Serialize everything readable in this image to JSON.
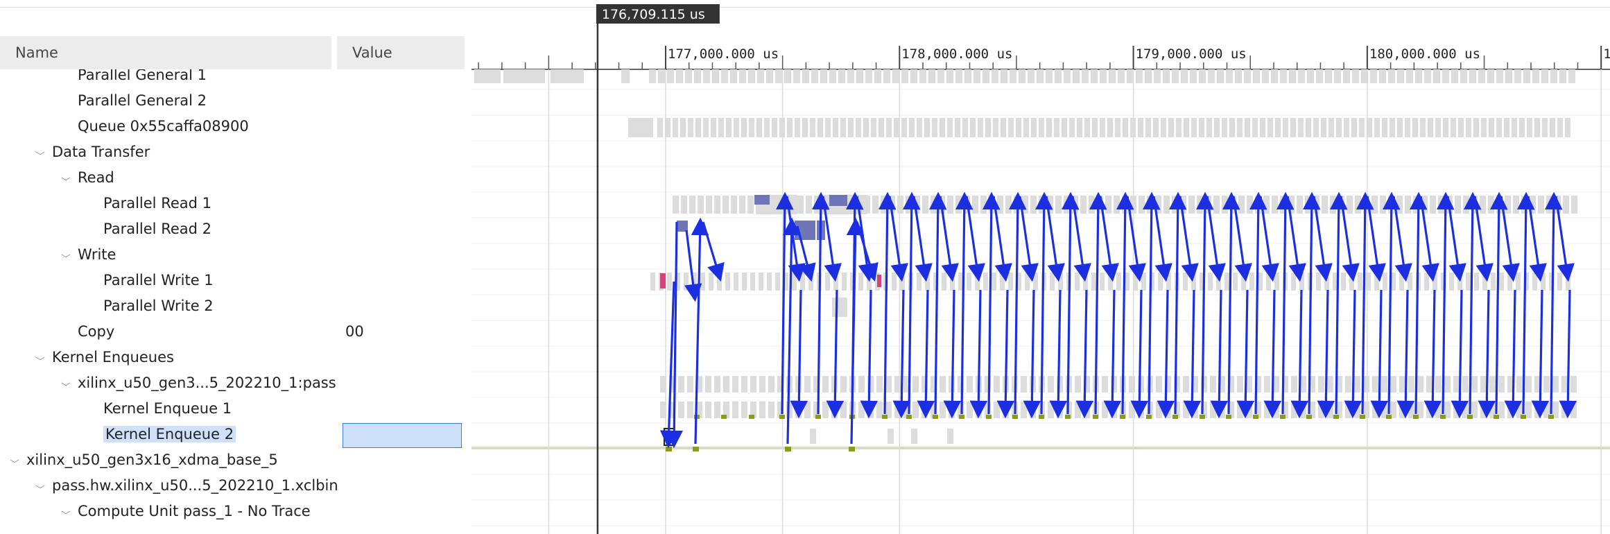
{
  "cursor": {
    "label": "176,709.115 us"
  },
  "columns": {
    "name": "Name",
    "value": "Value"
  },
  "timeline": {
    "start_us": 176000.0,
    "end_us": 180980.0,
    "cursor_us": 176709.115,
    "major_ticks": [
      {
        "us": 177000.0,
        "label": "177,000.000 us"
      },
      {
        "us": 178000.0,
        "label": "178,000.000 us"
      },
      {
        "us": 179000.0,
        "label": "179,000.000 us"
      },
      {
        "us": 180000.0,
        "label": "180,000.000 us"
      },
      {
        "us": 181000.0,
        "label": "1"
      }
    ]
  },
  "rows": [
    {
      "label": "Parallel General 1",
      "indent": 2,
      "chevron": false,
      "value": "",
      "selected": false
    },
    {
      "label": "Parallel General 2",
      "indent": 2,
      "chevron": false,
      "value": "",
      "selected": false
    },
    {
      "label": "Queue 0x55caffa08900",
      "indent": 2,
      "chevron": false,
      "value": "",
      "selected": false
    },
    {
      "label": "Data Transfer",
      "indent": 1,
      "chevron": true,
      "value": "",
      "selected": false
    },
    {
      "label": "Read",
      "indent": 2,
      "chevron": true,
      "value": "",
      "selected": false
    },
    {
      "label": "Parallel Read 1",
      "indent": 3,
      "chevron": false,
      "value": "",
      "selected": false
    },
    {
      "label": "Parallel Read 2",
      "indent": 3,
      "chevron": false,
      "value": "",
      "selected": false
    },
    {
      "label": "Write",
      "indent": 2,
      "chevron": true,
      "value": "",
      "selected": false
    },
    {
      "label": "Parallel Write 1",
      "indent": 3,
      "chevron": false,
      "value": "",
      "selected": false
    },
    {
      "label": "Parallel Write 2",
      "indent": 3,
      "chevron": false,
      "value": "",
      "selected": false
    },
    {
      "label": "Copy",
      "indent": 2,
      "chevron": false,
      "value": "00",
      "selected": false
    },
    {
      "label": "Kernel Enqueues",
      "indent": 1,
      "chevron": true,
      "value": "",
      "selected": false
    },
    {
      "label": "xilinx_u50_gen3...5_202210_1:pass",
      "indent": 2,
      "chevron": true,
      "value": "",
      "selected": false
    },
    {
      "label": "Kernel Enqueue 1",
      "indent": 3,
      "chevron": false,
      "value": "",
      "selected": false
    },
    {
      "label": "Kernel Enqueue 2",
      "indent": 3,
      "chevron": false,
      "value": "",
      "selected": true
    },
    {
      "label": "xilinx_u50_gen3x16_xdma_base_5",
      "indent": 0,
      "chevron": true,
      "value": "",
      "selected": false
    },
    {
      "label": "pass.hw.xilinx_u50...5_202210_1.xclbin",
      "indent": 1,
      "chevron": true,
      "value": "",
      "selected": false
    },
    {
      "label": "Compute Unit pass_1 - No Trace",
      "indent": 2,
      "chevron": true,
      "value": "",
      "selected": false
    }
  ],
  "icons": {
    "expand": "chevron-down-icon"
  },
  "colors": {
    "event_gray": "#dcdcdc",
    "read_block": "#6f76b8",
    "dependency_arrow": "#1c2fe0",
    "write_marker": "#d8407a",
    "enqueue_marker": "#8c9a1a",
    "selected_row_bg": "#cfe0fb",
    "selected_border": "#3f7fd6"
  }
}
